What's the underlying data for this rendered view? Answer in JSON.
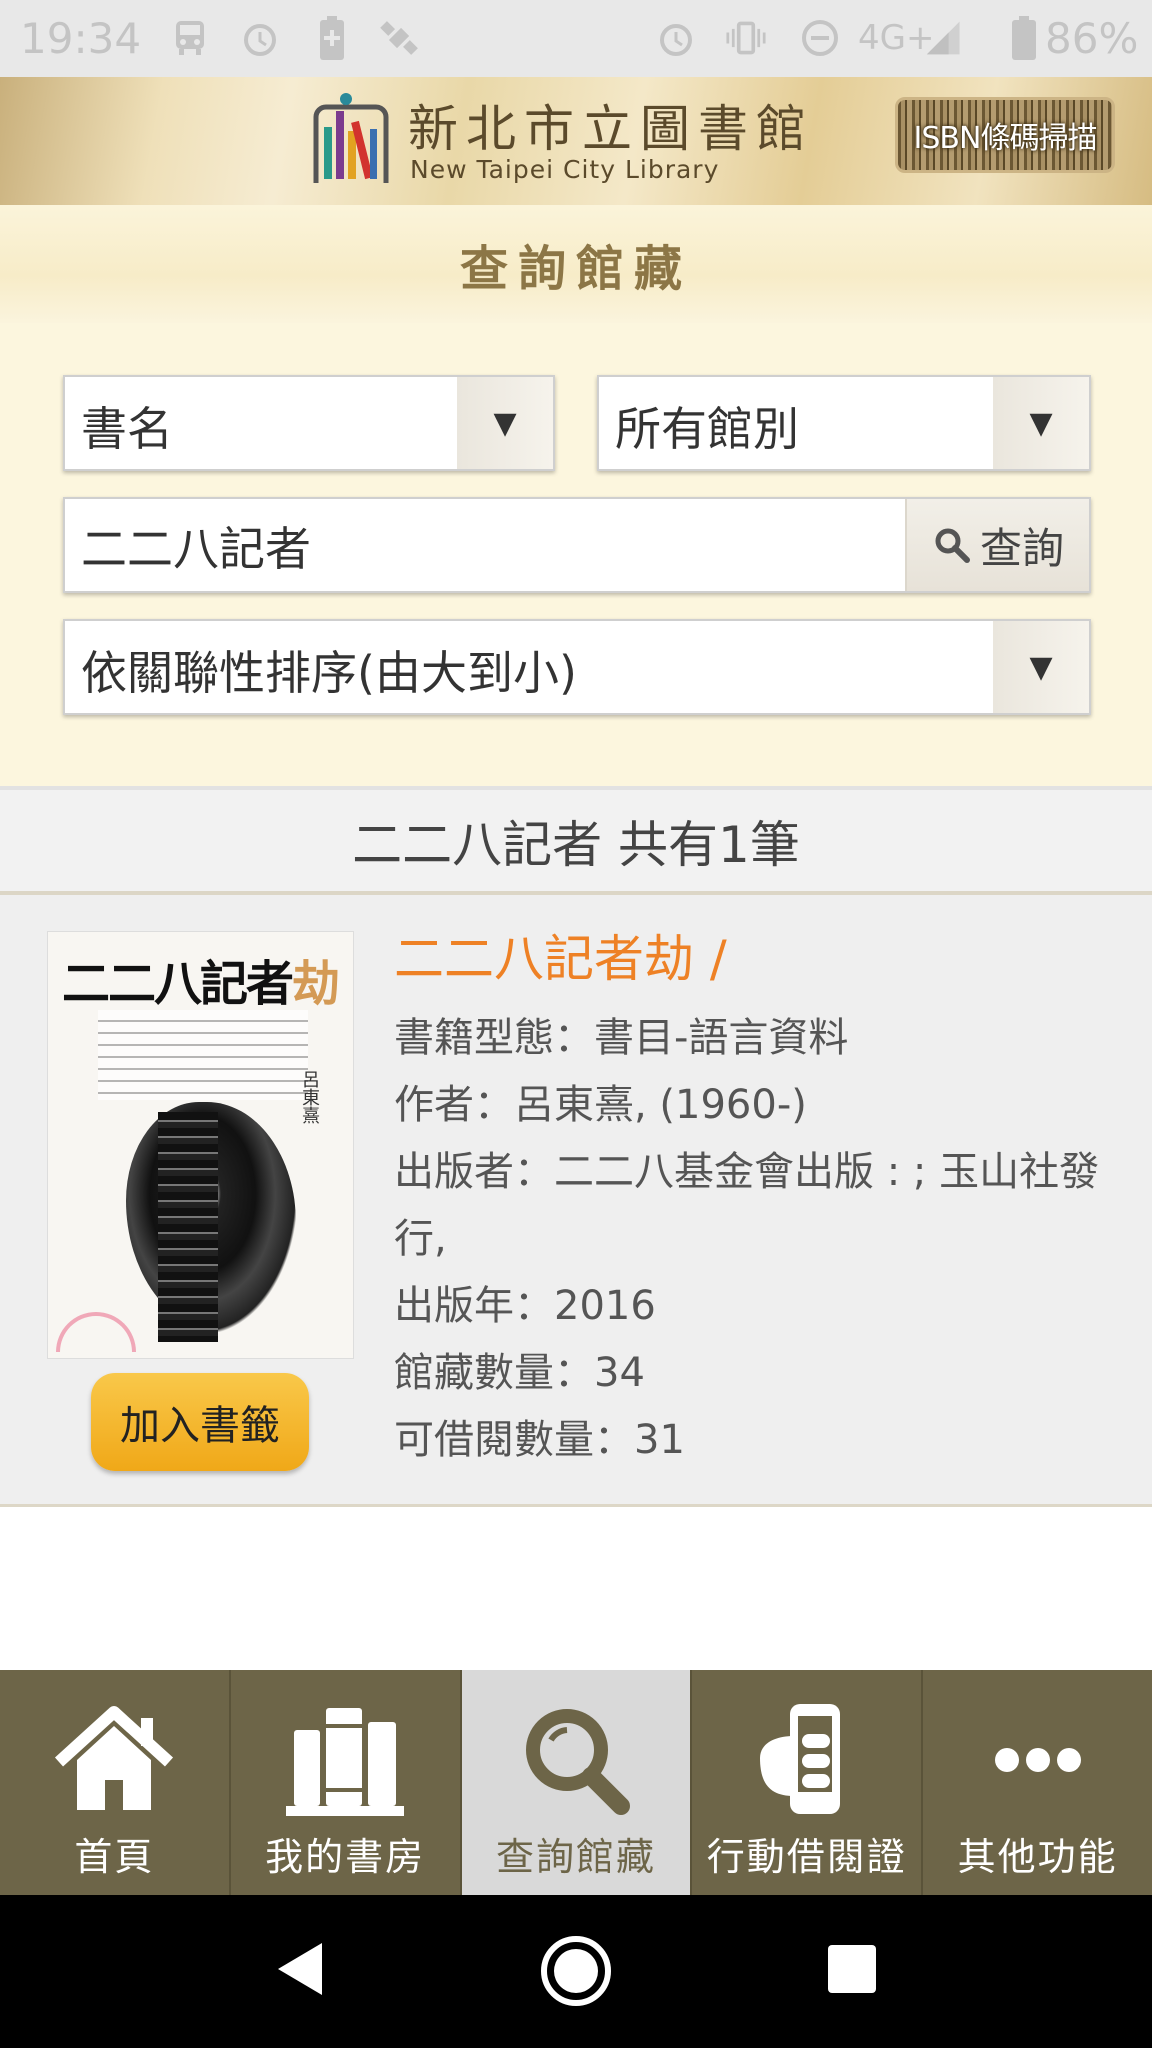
{
  "status_bar": {
    "time": "19:34",
    "network": "4G+",
    "battery": "86%"
  },
  "header": {
    "logo_zh": "新北市立圖書館",
    "logo_en": "New Taipei City Library",
    "isbn_button": "ISBN條碼掃描"
  },
  "page_title": "查詢館藏",
  "search": {
    "field_select": "書名",
    "branch_select": "所有館別",
    "query": "二二八記者",
    "search_button": "查詢",
    "sort_select": "依關聯性排序(由大到小)"
  },
  "result_summary": "二二八記者 共有1筆",
  "results": [
    {
      "cover_title_main": "二二八記者",
      "cover_title_accent": "劫",
      "cover_author": "呂東熹",
      "title": "二二八記者劫 /",
      "type": "書籍型態：書目-語言資料",
      "author": "作者：呂東熹, (1960-)",
      "publisher": "出版者：二二八基金會出版 : ; 玉山社發行,",
      "year": "出版年：2016",
      "holdings": "館藏數量：34",
      "available": "可借閱數量：31",
      "bookmark_button": "加入書籤"
    }
  ],
  "tabs": [
    {
      "label": "首頁",
      "icon": "home-icon",
      "active": false
    },
    {
      "label": "我的書房",
      "icon": "books-icon",
      "active": false
    },
    {
      "label": "查詢館藏",
      "icon": "search-icon",
      "active": true
    },
    {
      "label": "行動借閱證",
      "icon": "phone-card-icon",
      "active": false
    },
    {
      "label": "其他功能",
      "icon": "more-icon",
      "active": false
    }
  ],
  "colors": {
    "accent_orange": "#ee8125",
    "tab_bar": "#6d6548",
    "bookmark_button": "#f4b52c",
    "title_text": "#8c7646"
  }
}
